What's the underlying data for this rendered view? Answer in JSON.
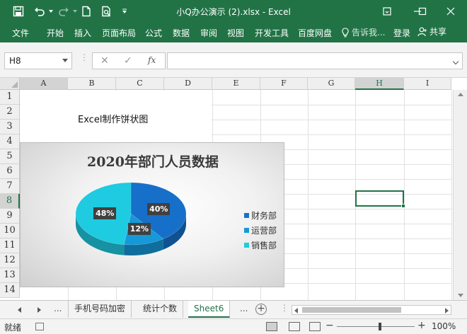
{
  "window": {
    "title": "小Q办公演示 (2).xlsx - Excel",
    "brand_color": "#217346"
  },
  "quick_access": {
    "icons": [
      "save-icon",
      "undo-icon",
      "redo-icon",
      "new-document-icon",
      "print-preview-icon",
      "customize-dropdown-icon"
    ]
  },
  "ribbon": {
    "tabs": [
      "文件",
      "开始",
      "插入",
      "页面布局",
      "公式",
      "数据",
      "审阅",
      "视图",
      "开发工具",
      "百度网盘"
    ],
    "tell_me": "告诉我...",
    "login": "登录",
    "share": "共享"
  },
  "formula_bar": {
    "name_box": "H8",
    "cancel": "✕",
    "confirm": "✓",
    "fx": "fx",
    "value": ""
  },
  "columns": [
    "A",
    "B",
    "C",
    "D",
    "E",
    "F",
    "G",
    "H",
    "I"
  ],
  "rows": [
    "1",
    "2",
    "3",
    "4",
    "5",
    "6",
    "7",
    "8",
    "9",
    "10",
    "11",
    "12",
    "13",
    "14"
  ],
  "selected_cell": "H8",
  "cells": {
    "B3": "Excel制作饼状图"
  },
  "chart_data": {
    "type": "pie",
    "title": "2020年部门人员数据",
    "categories": [
      "财务部",
      "运营部",
      "销售部"
    ],
    "values": [
      40,
      12,
      48
    ],
    "labels": [
      "40%",
      "12%",
      "48%"
    ],
    "colors": [
      "#1670c9",
      "#1599d8",
      "#1ecbe1"
    ],
    "style": "3d",
    "legend_position": "right"
  },
  "sheet_tabs": {
    "tabs": [
      "手机号码加密",
      "统计个数",
      "Sheet6"
    ],
    "active": "Sheet6",
    "more": "...",
    "add": "+"
  },
  "status_bar": {
    "ready": "就绪",
    "zoom_minus": "−",
    "zoom_plus": "+",
    "zoom": "100%"
  }
}
